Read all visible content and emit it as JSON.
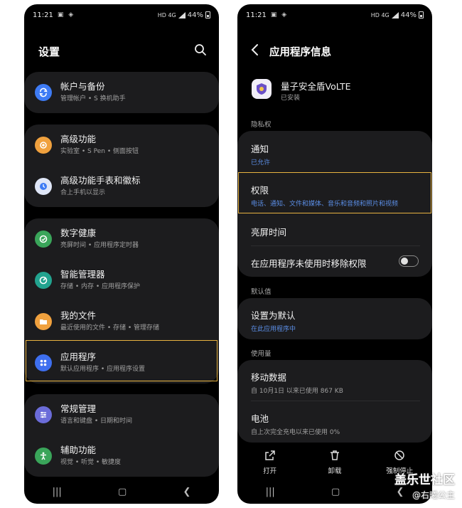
{
  "status_bar": {
    "time": "11:21",
    "left_icons": "▣ ◈",
    "network": "HD 4G",
    "battery": "44%"
  },
  "left": {
    "title": "设置",
    "groups": [
      {
        "items": [
          {
            "title": "帐户与备份",
            "subtitle": "管理帐户 • S 换机助手",
            "icon": "sync-icon",
            "color": "#3e7bf4"
          }
        ]
      },
      {
        "items": [
          {
            "title": "高级功能",
            "subtitle": "实验室 • S Pen • 侧面按钮",
            "icon": "gear-plus-icon",
            "color": "#f0a13e"
          },
          {
            "title": "高级功能手表和徽标",
            "subtitle": "合上手机以显示",
            "icon": "watch-icon",
            "color": "#3e7bf4"
          }
        ]
      },
      {
        "items": [
          {
            "title": "数字健康",
            "subtitle": "亮屏时间 • 应用程序定时器",
            "icon": "wellbeing-icon",
            "color": "#3aa55a"
          },
          {
            "title": "智能管理器",
            "subtitle": "存储 • 内存 • 应用程序保护",
            "icon": "care-icon",
            "color": "#22a38f"
          },
          {
            "title": "我的文件",
            "subtitle": "最近使用的文件 • 存储 • 管理存储",
            "icon": "folder-icon",
            "color": "#f0a13e"
          },
          {
            "title": "应用程序",
            "subtitle": "默认应用程序 • 应用程序设置",
            "icon": "apps-icon",
            "color": "#3e6fef"
          }
        ]
      },
      {
        "items": [
          {
            "title": "常规管理",
            "subtitle": "语言和键盘 • 日期和时间",
            "icon": "sliders-icon",
            "color": "#6b6cd9"
          },
          {
            "title": "辅助功能",
            "subtitle": "视觉 • 听觉 • 敏捷度",
            "icon": "accessibility-icon",
            "color": "#3aa55a"
          }
        ]
      }
    ]
  },
  "right": {
    "title": "应用程序信息",
    "app_name": "量子安全盾VoLTE",
    "app_status": "已安装",
    "sections": {
      "privacy": "隐私权",
      "defaults": "默认值",
      "usage": "使用量"
    },
    "notification": {
      "title": "通知",
      "subtitle": "已允许"
    },
    "permissions": {
      "title": "权限",
      "subtitle": "电话、通知、文件和媒体、音乐和音频和照片和视频"
    },
    "screen_time": {
      "title": "亮屏时间"
    },
    "remove_perm": {
      "title": "在应用程序未使用时移除权限"
    },
    "set_default": {
      "title": "设置为默认",
      "subtitle": "在此应用程序中"
    },
    "mobile_data": {
      "title": "移动数据",
      "subtitle": "自 10月1日 以来已使用 867 KB"
    },
    "battery": {
      "title": "电池",
      "subtitle": "自上次完全充电以来已使用 0%"
    },
    "actions": {
      "open": "打开",
      "uninstall": "卸载",
      "force_stop": "强制停止"
    }
  },
  "watermark": {
    "line1": "盖乐世社区",
    "line2": "@右曦公主"
  }
}
